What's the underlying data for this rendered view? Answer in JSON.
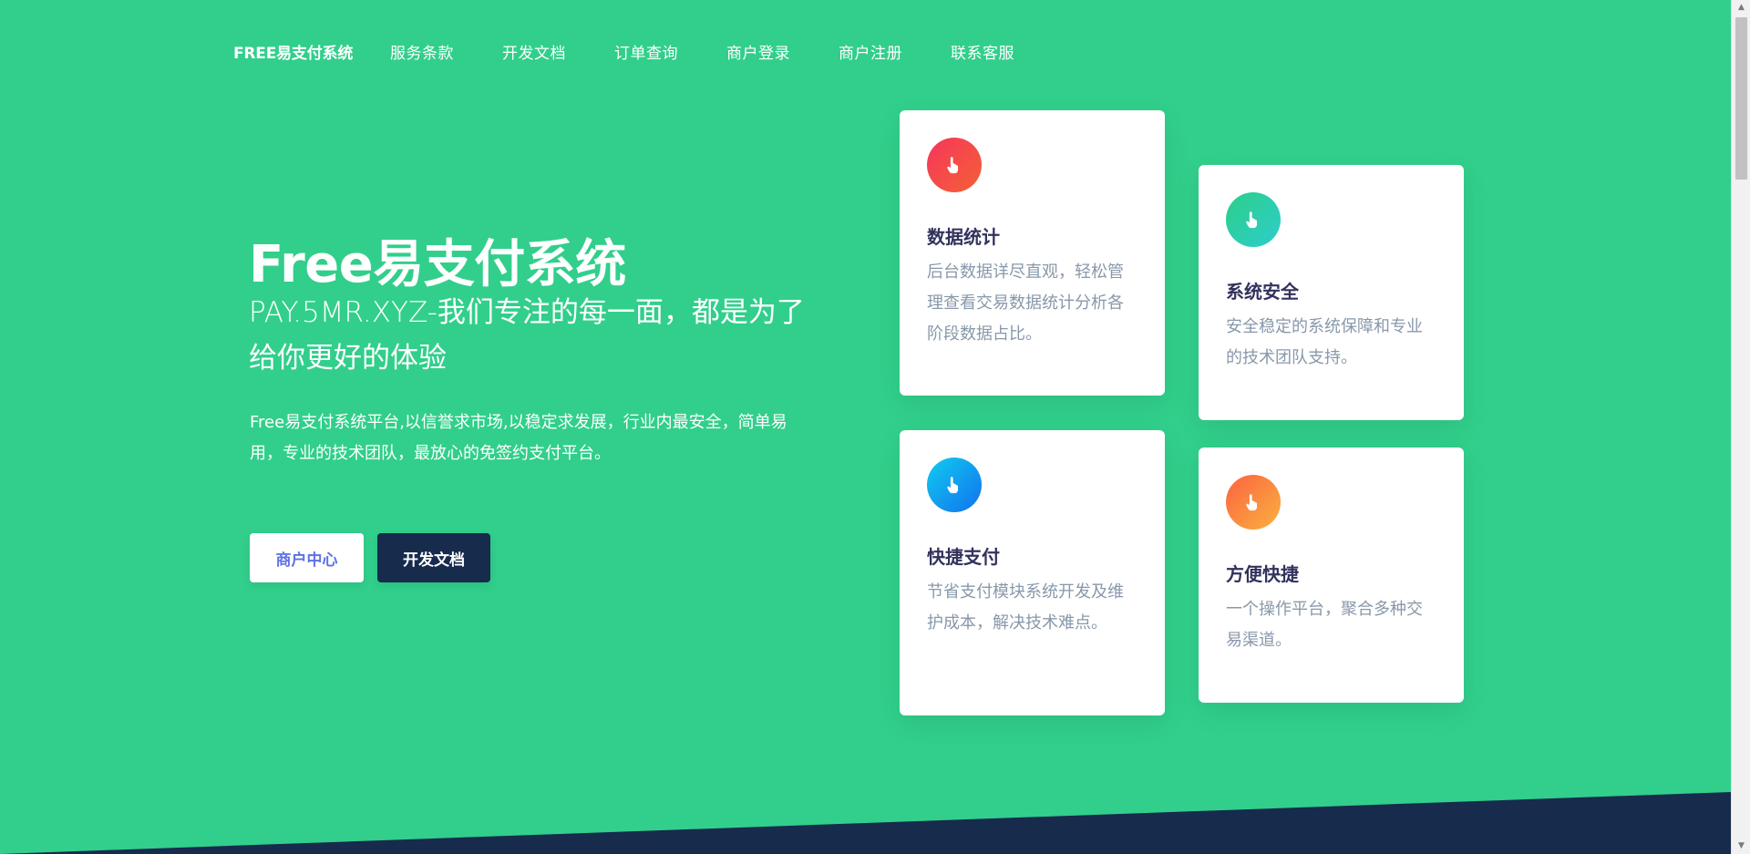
{
  "nav": {
    "brand": "FREE易支付系统",
    "items": [
      {
        "label": "服务条款"
      },
      {
        "label": "开发文档"
      },
      {
        "label": "订单查询"
      },
      {
        "label": "商户登录"
      },
      {
        "label": "商户注册"
      },
      {
        "label": "联系客服"
      }
    ]
  },
  "hero": {
    "title": "Free易支付系统",
    "subtitle": "PAY.5MR.XYZ-我们专注的每一面，都是为了给你更好的体验",
    "description": "Free易支付系统平台,以信誉求市场,以稳定求发展，行业内最安全，简单易用，专业的技术团队，最放心的免签约支付平台。",
    "buttons": {
      "merchant": "商户中心",
      "docs": "开发文档"
    }
  },
  "features": [
    {
      "title": "数据统计",
      "text": "后台数据详尽直观，轻松管理查看交易数据统计分析各阶段数据占比。",
      "icon": "hand-pointer-icon"
    },
    {
      "title": "系统安全",
      "text": "安全稳定的系统保障和专业的技术团队支持。",
      "icon": "hand-pointer-icon"
    },
    {
      "title": "快捷支付",
      "text": "节省支付模块系统开发及维护成本，解决技术难点。",
      "icon": "hand-pointer-icon"
    },
    {
      "title": "方便快捷",
      "text": "一个操作平台，聚合多种交易渠道。",
      "icon": "hand-pointer-icon"
    }
  ],
  "colors": {
    "background": "#31cf8b",
    "dark": "#172b4d",
    "accent": "#5e72e4"
  }
}
